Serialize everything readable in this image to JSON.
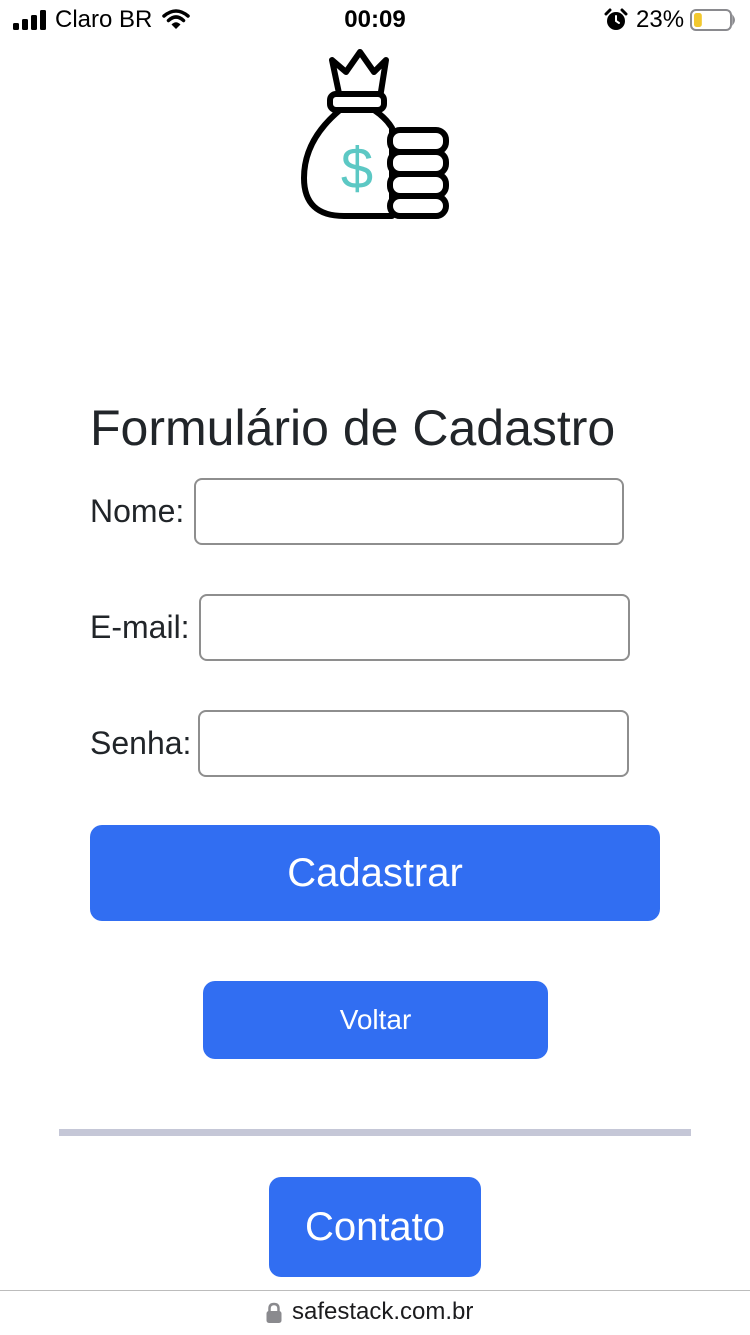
{
  "status_bar": {
    "carrier": "Claro BR",
    "time": "00:09",
    "battery_percent": "23%",
    "battery_level": 0.23,
    "icons": [
      "signal-icon",
      "wifi-icon",
      "alarm-icon",
      "battery-icon"
    ]
  },
  "logo": {
    "icon": "money-bag-coins-icon",
    "symbol": "$"
  },
  "form": {
    "title": "Formulário de Cadastro",
    "fields": [
      {
        "label": "Nome:",
        "value": "",
        "placeholder": ""
      },
      {
        "label": "E-mail:",
        "value": "",
        "placeholder": ""
      },
      {
        "label": "Senha:",
        "value": "",
        "placeholder": ""
      }
    ],
    "submit_label": "Cadastrar",
    "back_label": "Voltar"
  },
  "footer": {
    "contact_label": "Contato"
  },
  "browser": {
    "url": "safestack.com.br",
    "lock_icon": "lock-icon"
  },
  "colors": {
    "primary": "#316ef2",
    "divider": "#c5c7d7",
    "logo_accent": "#5cc8c4",
    "text": "#212529",
    "battery_fill": "#f2c82e"
  }
}
